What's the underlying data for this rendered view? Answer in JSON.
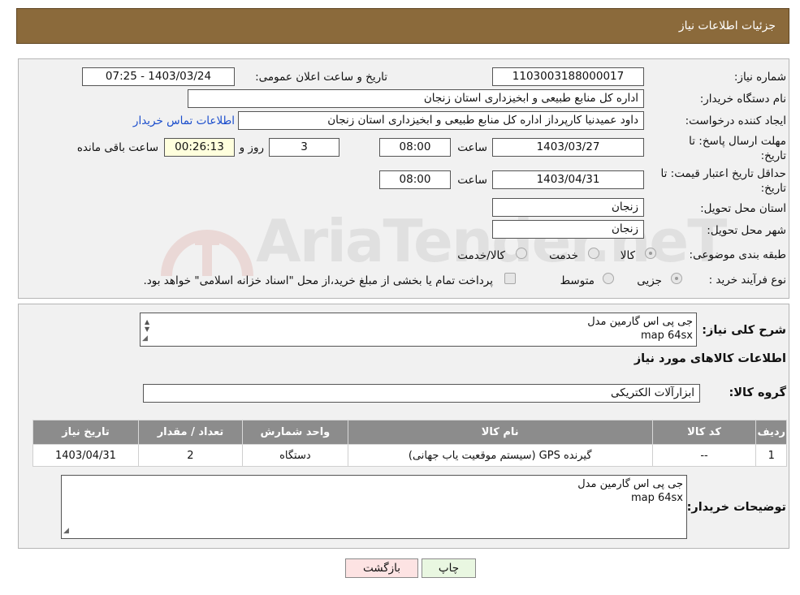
{
  "header": {
    "title": "جزئیات اطلاعات نیاز"
  },
  "watermark": {
    "text": "AriaTender.neT"
  },
  "form": {
    "need_number_label": "شماره نیاز:",
    "need_number": "1103003188000017",
    "announce_label": "تاریخ و ساعت اعلان عمومی:",
    "announce_value": "1403/03/24 - 07:25",
    "buyer_label": "نام دستگاه خریدار:",
    "buyer_value": "اداره کل منابع طبیعی و ابخیزداری استان زنجان",
    "creator_label": "ایجاد کننده درخواست:",
    "creator_value": "داود عمیدنیا کارپرداز اداره کل منابع طبیعی و ابخیزداری استان زنجان",
    "contact_link": "اطلاعات تماس خریدار",
    "deadline_label": "مهلت ارسال پاسخ: تا تاریخ:",
    "deadline_date": "1403/03/27",
    "time_label": "ساعت",
    "deadline_time": "08:00",
    "days_value": "3",
    "days_label": "روز و",
    "remaining_value": "00:26:13",
    "remaining_label": "ساعت باقی مانده",
    "validity_label": "حداقل تاریخ اعتبار قیمت: تا تاریخ:",
    "validity_date": "1403/04/31",
    "validity_time": "08:00",
    "province_label": "استان محل تحویل:",
    "province_value": "زنجان",
    "city_label": "شهر محل تحویل:",
    "city_value": "زنجان",
    "category_label": "طبقه بندی موضوعی:",
    "category_options": [
      "کالا",
      "خدمت",
      "کالا/خدمت"
    ],
    "category_selected": "کالا",
    "process_label": "نوع فرآیند خرید :",
    "process_options": [
      "جزیی",
      "متوسط"
    ],
    "process_selected": "جزیی",
    "payment_note": "پرداخت تمام یا بخشی از مبلغ خرید،از محل \"اسناد خزانه اسلامی\" خواهد بود."
  },
  "details": {
    "summary_label": "شرح کلی نیاز:",
    "summary_line1": "جی پی اس گارمین مدل",
    "summary_line2": "map 64sx",
    "goods_info_title": "اطلاعات کالاهای مورد نیاز",
    "group_label": "گروه کالا:",
    "group_value": "ابزارآلات الکتریکی",
    "table": {
      "headers": [
        "ردیف",
        "کد کالا",
        "نام کالا",
        "واحد شمارش",
        "تعداد / مقدار",
        "تاریخ نیاز"
      ],
      "rows": [
        [
          "1",
          "--",
          "گیرنده GPS (سیستم موقعیت یاب جهانی)",
          "دستگاه",
          "2",
          "1403/04/31"
        ]
      ]
    },
    "buyer_notes_label": "توضیحات خریدار:",
    "buyer_notes_line1": "جی پی اس گارمین مدل",
    "buyer_notes_line2": "map 64sx"
  },
  "buttons": {
    "print": "چاپ",
    "back": "بازگشت"
  },
  "colors": {
    "header_bg": "#8b6a3b",
    "table_header": "#8c8c8c",
    "link": "#1a4dcc",
    "back_btn": "#fde3e3",
    "print_btn": "#e9f7e1"
  }
}
